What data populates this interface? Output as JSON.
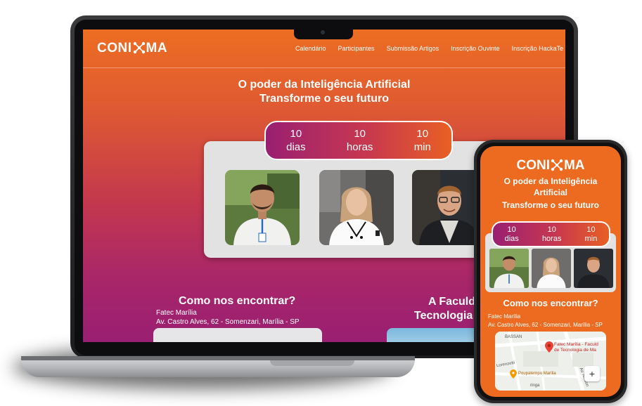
{
  "brand": {
    "logo_left": "CONI",
    "logo_right": "MA",
    "accent": "#ec6b20",
    "gradient_end": "#9a1f72"
  },
  "nav": {
    "links": [
      "Calendário",
      "Participantes",
      "Submissão Artigos",
      "Inscrição Ouvinte",
      "Inscrição HackaTe"
    ]
  },
  "hero": {
    "line1": "O poder da Inteligência Artificial",
    "line2": "Transforme o seu futuro"
  },
  "countdown": [
    {
      "value": "10",
      "unit": "dias"
    },
    {
      "value": "10",
      "unit": "horas"
    },
    {
      "value": "10",
      "unit": "min"
    }
  ],
  "location": {
    "heading": "Como nos encontrar?",
    "place": "Fatec Marília",
    "address": "Av. Castro Alves, 62 - Somenzari, Marília - SP"
  },
  "faculty": {
    "heading_line1": "A Faculd",
    "heading_line2": "Tecnologia"
  },
  "phone": {
    "title_line1": "O poder da Inteligência",
    "title_line2": "Artificial",
    "title_line3": "Transforme o seu futuro",
    "map": {
      "street1": "BASSAN",
      "street2": "Lorenzetti",
      "pin_line1": "Fatec Marília - Faculd",
      "pin_line2": "de Tecnologia de Ma",
      "poi": "Poupatempo Marília",
      "street3": "Av. Nelson",
      "street4": "ringa",
      "zoom": "+"
    }
  }
}
